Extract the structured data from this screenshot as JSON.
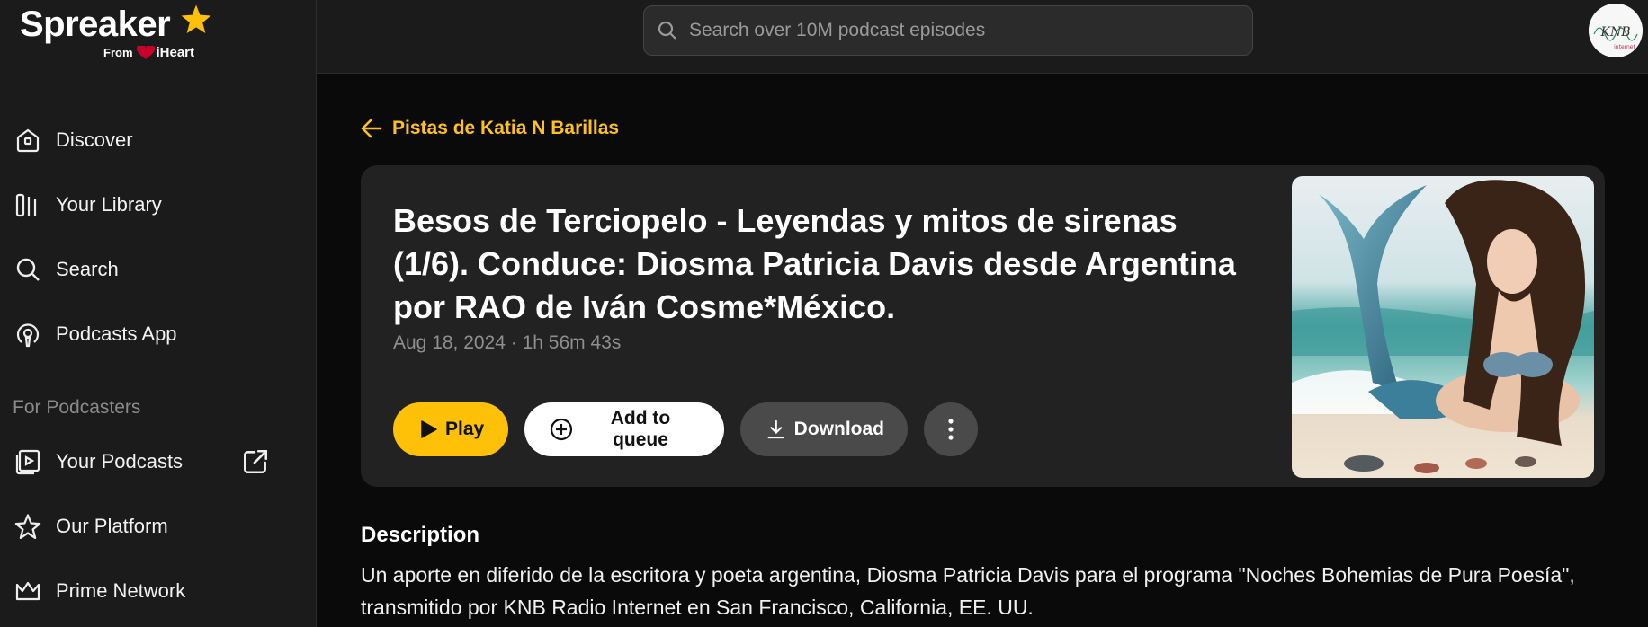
{
  "brand": {
    "name": "Spreaker",
    "from": "From",
    "partner": "iHeart",
    "accent": "#ffc107"
  },
  "search": {
    "placeholder": "Search over 10M podcast episodes"
  },
  "sidebar": {
    "items": [
      {
        "label": "Discover",
        "icon": "home-icon"
      },
      {
        "label": "Your Library",
        "icon": "library-icon"
      },
      {
        "label": "Search",
        "icon": "search-icon"
      },
      {
        "label": "Podcasts App",
        "icon": "podcast-icon"
      }
    ],
    "section_title": "For Podcasters",
    "podcaster_items": [
      {
        "label": "Your Podcasts",
        "icon": "podcasts-play-icon"
      },
      {
        "label": "Our Platform",
        "icon": "star-outline-icon"
      },
      {
        "label": "Prime Network",
        "icon": "crown-icon"
      }
    ]
  },
  "episode": {
    "back_label": "Pistas de Katia N Barillas",
    "title": "Besos de Terciopelo - Leyendas y mitos de sirenas (1/6). Conduce: Diosma Patricia Davis desde Argentina por RAO de Iván Cosme*México.",
    "meta": "Aug 18, 2024 · 1h 56m 43s",
    "play_label": "Play",
    "queue_label": "Add to queue",
    "download_label": "Download"
  },
  "description": {
    "heading": "Description",
    "text": "Un aporte en diferido de la escritora y poeta argentina, Diosma Patricia Davis para el programa \"Noches Bohemias de Pura Poesía\", transmitido por KNB Radio Internet en San Francisco, California, EE. UU."
  },
  "avatar": {
    "text": "KNB"
  }
}
